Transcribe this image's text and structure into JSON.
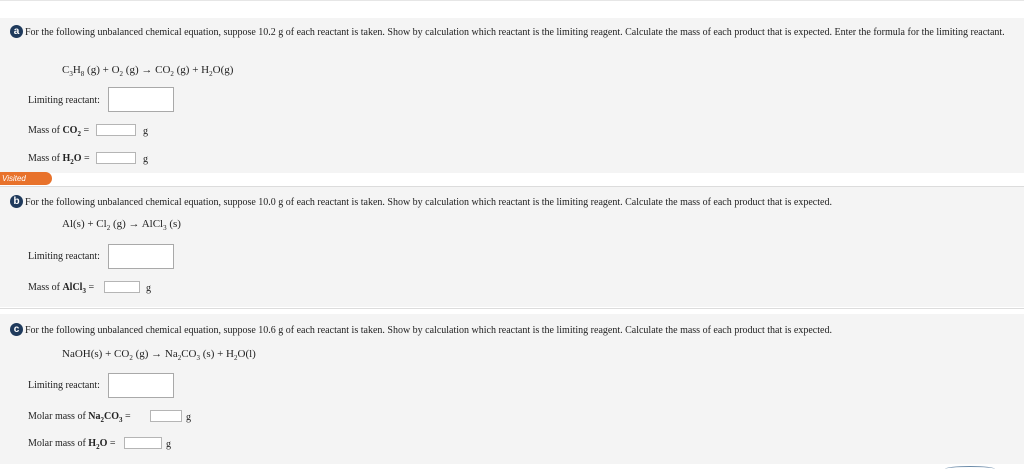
{
  "visited_label": "Visited",
  "parts": {
    "a": {
      "badge": "a",
      "prompt": "For the following unbalanced chemical equation, suppose 10.2 g of each reactant is taken. Show by calculation which reactant is the limiting reagent. Calculate the mass of each product that is expected. Enter the formula for the limiting reactant.",
      "equation": [
        "C",
        "3",
        "H",
        "8",
        " (g) + O",
        "2",
        " (g) → CO",
        "2",
        " (g) + H",
        "2",
        "O(g)"
      ],
      "limiting_label": "Limiting reactant:",
      "limiting_value": "",
      "mass1": {
        "prefix": "Mass of ",
        "formula": [
          "CO",
          "2"
        ],
        "eq": " =",
        "value": "",
        "unit": "g"
      },
      "mass2": {
        "prefix": "Mass of ",
        "formula": [
          "H",
          "2",
          "O"
        ],
        "eq": " =",
        "value": "",
        "unit": "g"
      }
    },
    "b": {
      "badge": "b",
      "prompt": "For the following unbalanced chemical equation, suppose 10.0 g of each reactant is taken. Show by calculation which reactant is the limiting reagent. Calculate the mass of each product that is expected.",
      "equation": [
        "Al(s) + Cl",
        "2",
        " (g) → AlCl",
        "3",
        " (s)"
      ],
      "limiting_label": "Limiting reactant:",
      "limiting_value": "",
      "mass1": {
        "prefix": "Mass of ",
        "formula": [
          "AlCl",
          "3"
        ],
        "eq": " =",
        "value": "",
        "unit": "g"
      }
    },
    "c": {
      "badge": "c",
      "prompt": "For the following unbalanced chemical equation, suppose 10.6 g of each reactant is taken. Show by calculation which reactant is the limiting reagent. Calculate the mass of each product that is expected.",
      "equation": [
        "NaOH(s) + CO",
        "2",
        " (g) → Na",
        "2",
        "CO",
        "3",
        " (s) + H",
        "2",
        "O(l)"
      ],
      "limiting_label": "Limiting reactant:",
      "limiting_value": "",
      "mass1": {
        "prefix": "Molar mass of ",
        "formula": [
          "Na",
          "2",
          "CO",
          "3"
        ],
        "eq": " =",
        "value": "",
        "unit": "g"
      },
      "mass2": {
        "prefix": "Molar mass of ",
        "formula": [
          "H",
          "2",
          "O"
        ],
        "eq": " =",
        "value": "",
        "unit": "g"
      }
    }
  },
  "colors": {
    "badge": "#1f3a5c",
    "visited": "#e8722b",
    "panel": "#f4f4f4"
  }
}
